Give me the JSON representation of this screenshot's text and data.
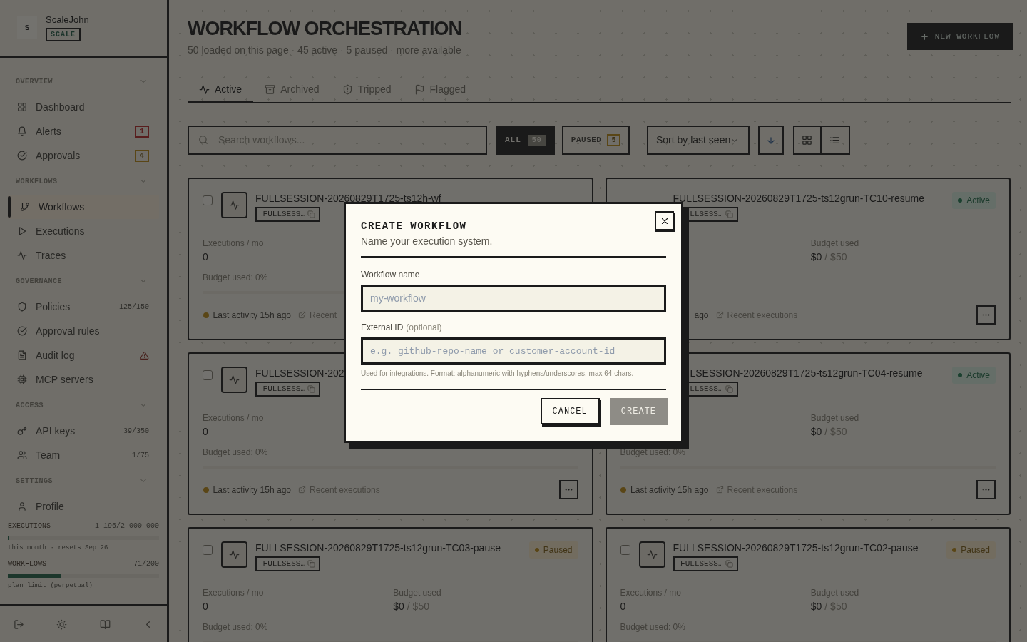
{
  "sidebar": {
    "avatar": "S",
    "user": "ScaleJohn",
    "plan": "SCALE",
    "sections": [
      {
        "title": "OVERVIEW",
        "expanded": true,
        "items": [
          {
            "label": "Dashboard",
            "selected": false
          },
          {
            "label": "Alerts",
            "selected": false,
            "trail": {
              "kind": "alert",
              "text": "1"
            }
          },
          {
            "label": "Approvals",
            "selected": false,
            "trail": {
              "kind": "pending",
              "text": "4"
            }
          }
        ]
      },
      {
        "title": "WORKFLOWS",
        "expanded": true,
        "items": [
          {
            "label": "Workflows",
            "selected": true
          },
          {
            "label": "Executions",
            "selected": false
          },
          {
            "label": "Traces",
            "selected": false
          }
        ]
      },
      {
        "title": "GOVERNANCE",
        "expanded": true,
        "items": [
          {
            "label": "Policies",
            "selected": false,
            "trail": {
              "kind": "count",
              "text": "125/150"
            }
          },
          {
            "label": "Approval rules",
            "selected": false
          },
          {
            "label": "Audit log",
            "selected": false,
            "trail": {
              "kind": "warning"
            }
          },
          {
            "label": "MCP servers",
            "selected": false
          }
        ]
      },
      {
        "title": "ACCESS",
        "expanded": true,
        "items": [
          {
            "label": "API keys",
            "selected": false,
            "trail": {
              "kind": "count",
              "text": "39/350"
            }
          },
          {
            "label": "Team",
            "selected": false,
            "trail": {
              "kind": "count",
              "text": "1/75"
            }
          }
        ]
      },
      {
        "title": "SETTINGS",
        "expanded": true,
        "items": [
          {
            "label": "Profile",
            "selected": false
          }
        ]
      }
    ],
    "usage": [
      {
        "label": "EXECUTIONS",
        "value": "1 196/2 000 000",
        "level": 0.0006,
        "note": "this month · resets Sep 26"
      },
      {
        "label": "WORKFLOWS",
        "value": "71/200",
        "level": 0.355,
        "note": "plan limit (perpetual)"
      }
    ]
  },
  "header": {
    "title": "WORKFLOW ORCHESTRATION",
    "subtitle": "50 loaded on this page · 45 active · 5 paused · more available",
    "new_button": "NEW WORKFLOW"
  },
  "tabs": [
    {
      "label": "Active",
      "selected": true
    },
    {
      "label": "Archived",
      "selected": false
    },
    {
      "label": "Tripped",
      "selected": false
    },
    {
      "label": "Flagged",
      "selected": false
    }
  ],
  "search": {
    "placeholder": "Search workflows..."
  },
  "filters": [
    {
      "label": "ALL",
      "count": "50",
      "selected": true
    },
    {
      "label": "PAUSED",
      "count": "5",
      "selected": false
    }
  ],
  "sort": {
    "label": "Sort by last seen"
  },
  "cards": [
    {
      "title": "FULLSESSION-20260829T1725-ts12h-wf",
      "chip": "FULLSESS…",
      "checked": false,
      "executions_label": "Executions / mo",
      "executions": "0",
      "budget_percent": "Budget used: 0%",
      "level": 0,
      "activity": {
        "label": "Last activity 15h ago",
        "dot": true
      },
      "recent": "Recent"
    },
    {
      "title": "FULLSESSION-20260829T1725-ts12grun-TC10-resume",
      "chip": "LLSESS…",
      "status": {
        "kind": "active",
        "label": "Active"
      },
      "budget_label": "Budget used",
      "budget_value": "$0",
      "budget_limit": "/ $50",
      "activity": {
        "label": "ago"
      },
      "recent": "Recent executions",
      "menu_button": true
    },
    {
      "title": "FULLSESSION-202",
      "chip": "FULLSESS…",
      "checked": false,
      "executions_label": "Executions / mo",
      "executions": "0",
      "budget_percent": "Budget used: 0%",
      "level": 0,
      "activity": {
        "label": "Last activity 15h ago",
        "dot": true
      },
      "recent": "Recent executions",
      "menu_button": true
    },
    {
      "title": "LSESSION-20260829T1725-ts12grun-TC04-resume",
      "clipped_left": true,
      "chip": "LLSESS…",
      "status": {
        "kind": "active",
        "label": "Active"
      },
      "budget_label": "Budget used",
      "budget_value": "$0",
      "budget_limit": "/ $50",
      "budget_percent": "Budget used: 0%",
      "level": 0,
      "activity": {
        "label": "Last activity 15h ago",
        "dot": true
      },
      "recent": "Recent executions",
      "menu_button": true
    },
    {
      "title": "FULLSESSION-20260829T1725-ts12grun-TC03-pause",
      "chip": "FULLSESS…",
      "checked": false,
      "status": {
        "kind": "paused",
        "label": "Paused"
      },
      "executions_label": "Executions / mo",
      "executions": "0",
      "budget_label": "Budget used",
      "budget_value": "$0",
      "budget_limit": "/ $50",
      "budget_percent": "Budget used: 0%",
      "level": 0
    },
    {
      "title": "FULLSESSION-20260829T1725-ts12grun-TC02-pause",
      "chip": "FULLSESS…",
      "checked": false,
      "status": {
        "kind": "paused",
        "label": "Paused"
      },
      "executions_label": "Executions / mo",
      "executions": "0",
      "budget_label": "Budget used",
      "budget_value": "$0",
      "budget_limit": "/ $50",
      "budget_percent": "Budget used: 0%",
      "level": 0
    }
  ],
  "modal": {
    "title": "CREATE WORKFLOW",
    "subtitle": "Name your execution system.",
    "fields": [
      {
        "kind": "text",
        "label": "Workflow name",
        "placeholder": "my-workflow"
      },
      {
        "kind": "code",
        "label": "External ID",
        "hint": "(optional)",
        "placeholder": "e.g. github-repo-name or customer-account-id",
        "help": "Used for integrations. Format: alphanumeric with hyphens/underscores, max 64 chars."
      }
    ],
    "buttons": [
      {
        "label": "CANCEL",
        "disabled": false
      },
      {
        "label": "CREATE",
        "disabled": true
      }
    ]
  }
}
